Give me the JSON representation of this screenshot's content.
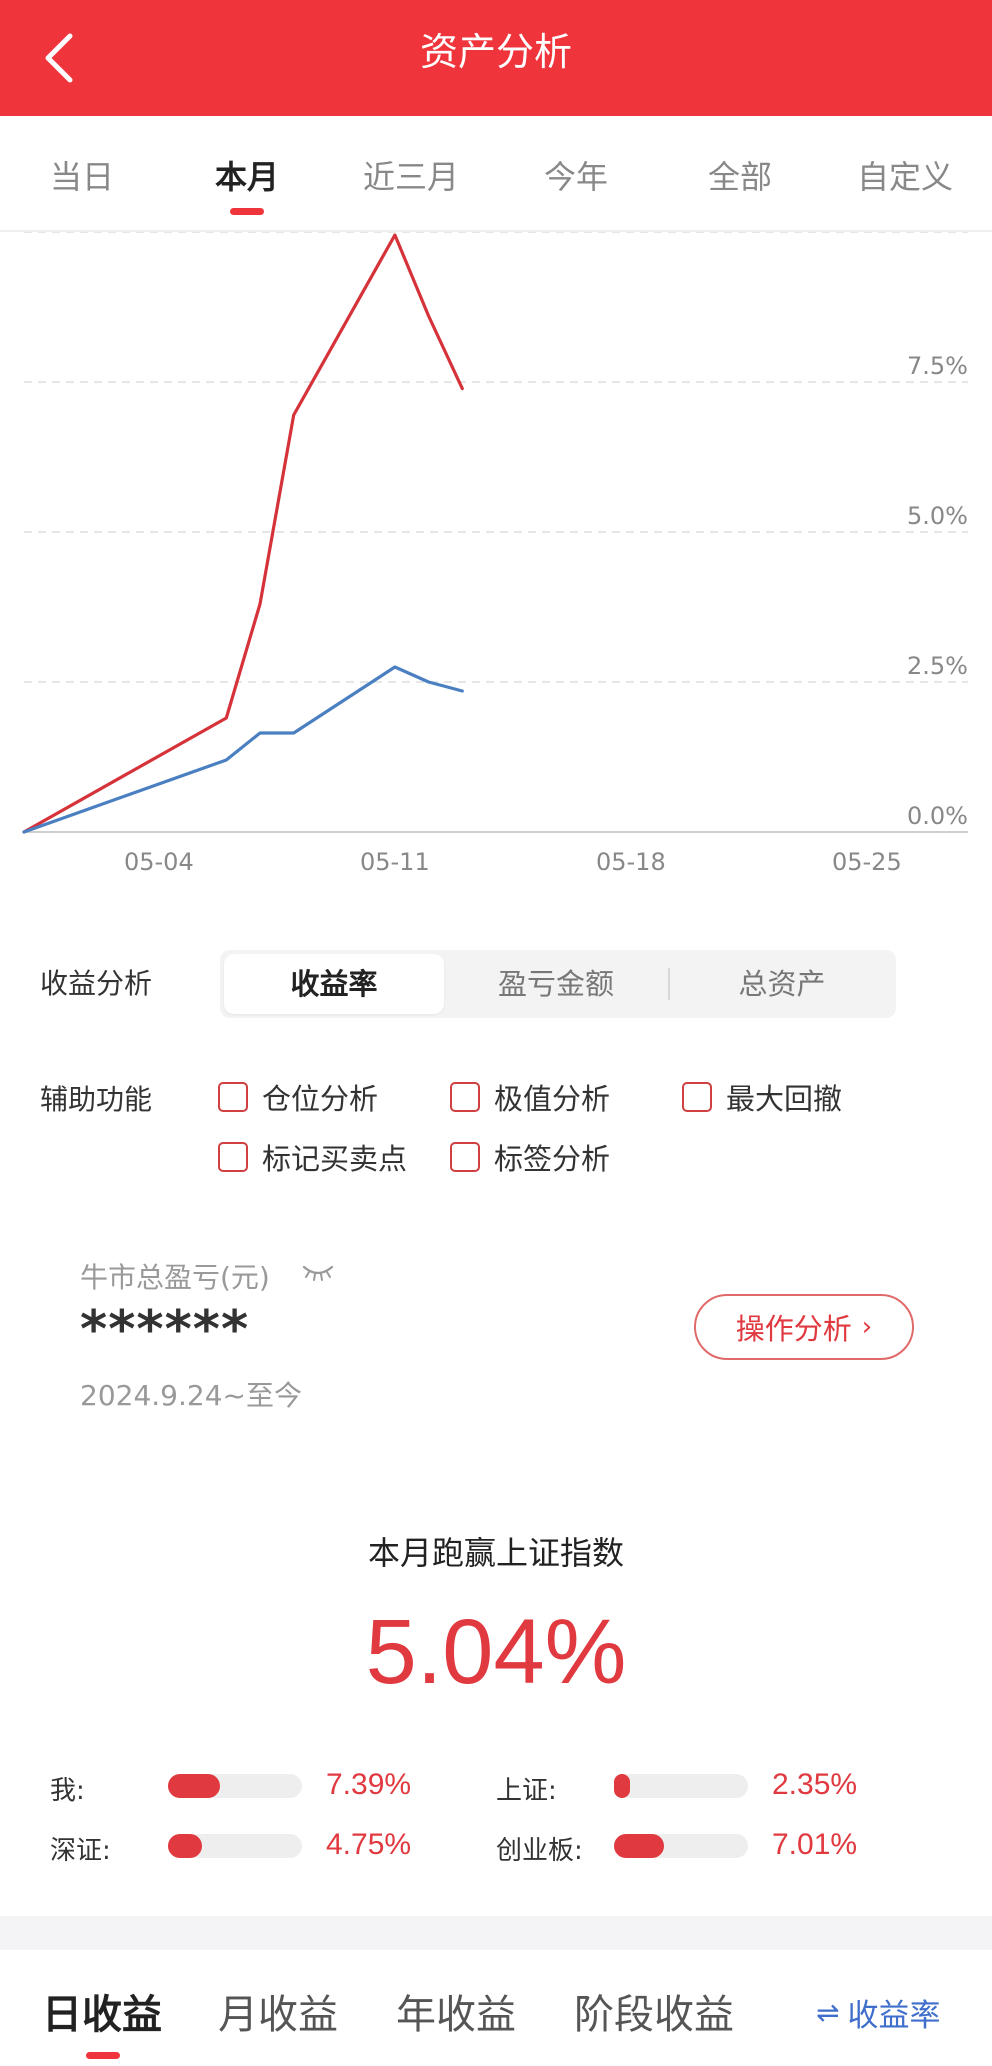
{
  "header": {
    "title": "资产分析",
    "back_icon": "back-arrow-icon"
  },
  "tabs": [
    {
      "label": "当日"
    },
    {
      "label": "本月",
      "active": true
    },
    {
      "label": "近三月"
    },
    {
      "label": "今年"
    },
    {
      "label": "全部"
    },
    {
      "label": "自定义"
    }
  ],
  "chart_data": {
    "type": "line",
    "x_ticks": [
      "05-04",
      "05-11",
      "05-18",
      "05-25"
    ],
    "y_ticks": [
      "0.0%",
      "2.5%",
      "5.0%",
      "7.5%"
    ],
    "ylim": [
      0,
      10
    ],
    "xlim": [
      "04-30",
      "05-28"
    ],
    "grid": true,
    "series": [
      {
        "color": "#d5323a",
        "points": [
          {
            "x": "04-30",
            "y": 0.0
          },
          {
            "x": "05-06",
            "y": 1.9
          },
          {
            "x": "05-07",
            "y": 3.8
          },
          {
            "x": "05-08",
            "y": 6.95
          },
          {
            "x": "05-11",
            "y": 9.95
          },
          {
            "x": "05-12",
            "y": 8.6
          },
          {
            "x": "05-13",
            "y": 7.39
          }
        ]
      },
      {
        "color": "#4a7fc1",
        "points": [
          {
            "x": "04-30",
            "y": 0.0
          },
          {
            "x": "05-06",
            "y": 1.2
          },
          {
            "x": "05-07",
            "y": 1.65
          },
          {
            "x": "05-08",
            "y": 1.65
          },
          {
            "x": "05-11",
            "y": 2.75
          },
          {
            "x": "05-12",
            "y": 2.5
          },
          {
            "x": "05-13",
            "y": 2.35
          }
        ]
      }
    ]
  },
  "analysis": {
    "label": "收益分析",
    "options": [
      "收益率",
      "盈亏金额",
      "总资产"
    ],
    "selected": "收益率"
  },
  "aux": {
    "label": "辅助功能",
    "options": [
      "仓位分析",
      "极值分析",
      "最大回撤",
      "标记买卖点",
      "标签分析"
    ]
  },
  "summary": {
    "label": "牛市总盈亏(元)",
    "eye_icon": "eye-closed-icon",
    "value": "******",
    "period": "2024.9.24~至今",
    "button": "操作分析",
    "button_icon": "chevron-right-icon"
  },
  "beat": {
    "title": "本月跑赢上证指数",
    "value": "5.04%",
    "accent": "#e0393f"
  },
  "compare": [
    {
      "label": "我:",
      "value": "7.39%",
      "level": 0.39
    },
    {
      "label": "上证:",
      "value": "2.35%",
      "level": 0.12
    },
    {
      "label": "深证:",
      "value": "4.75%",
      "level": 0.25
    },
    {
      "label": "创业板:",
      "value": "7.01%",
      "level": 0.37
    }
  ],
  "bottom_tabs": [
    {
      "label": "日收益",
      "active": true
    },
    {
      "label": "月收益"
    },
    {
      "label": "年收益"
    },
    {
      "label": "阶段收益"
    }
  ],
  "switch": {
    "label": "收益率",
    "icon": "swap-icon"
  }
}
